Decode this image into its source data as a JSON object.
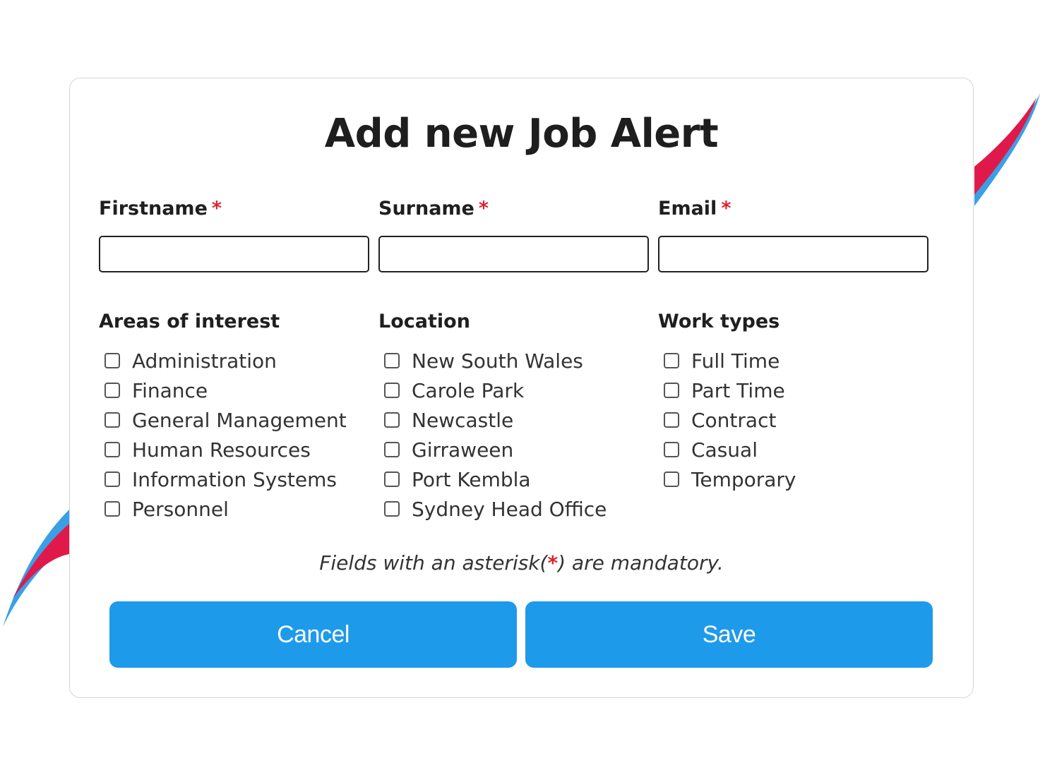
{
  "dialog": {
    "title": "Add new Job Alert",
    "required_mark": "*"
  },
  "fields": [
    {
      "label": "Firstname",
      "value": ""
    },
    {
      "label": "Surname",
      "value": ""
    },
    {
      "label": "Email",
      "value": ""
    }
  ],
  "groups": {
    "areas": {
      "title": "Areas of interest",
      "options": [
        "Administration",
        "Finance",
        "General Management",
        "Human Resources",
        "Information Systems",
        "Personnel"
      ]
    },
    "location": {
      "title": "Location",
      "options": [
        "New South Wales",
        "Carole Park",
        "Newcastle",
        "Girraween",
        "Port Kembla",
        "Sydney Head Office"
      ]
    },
    "work_types": {
      "title": "Work types",
      "options": [
        "Full Time",
        "Part Time",
        "Contract",
        "Casual",
        "Temporary"
      ]
    }
  },
  "note": {
    "before": "Fields with an asterisk(",
    "mark": "*",
    "after": ") are mandatory."
  },
  "buttons": {
    "cancel": "Cancel",
    "save": "Save"
  },
  "colors": {
    "accent_blue": "#1e9aeb",
    "required_red": "#e0222d",
    "swoosh_red": "#e0194b",
    "swoosh_blue": "#3aa0e6"
  }
}
